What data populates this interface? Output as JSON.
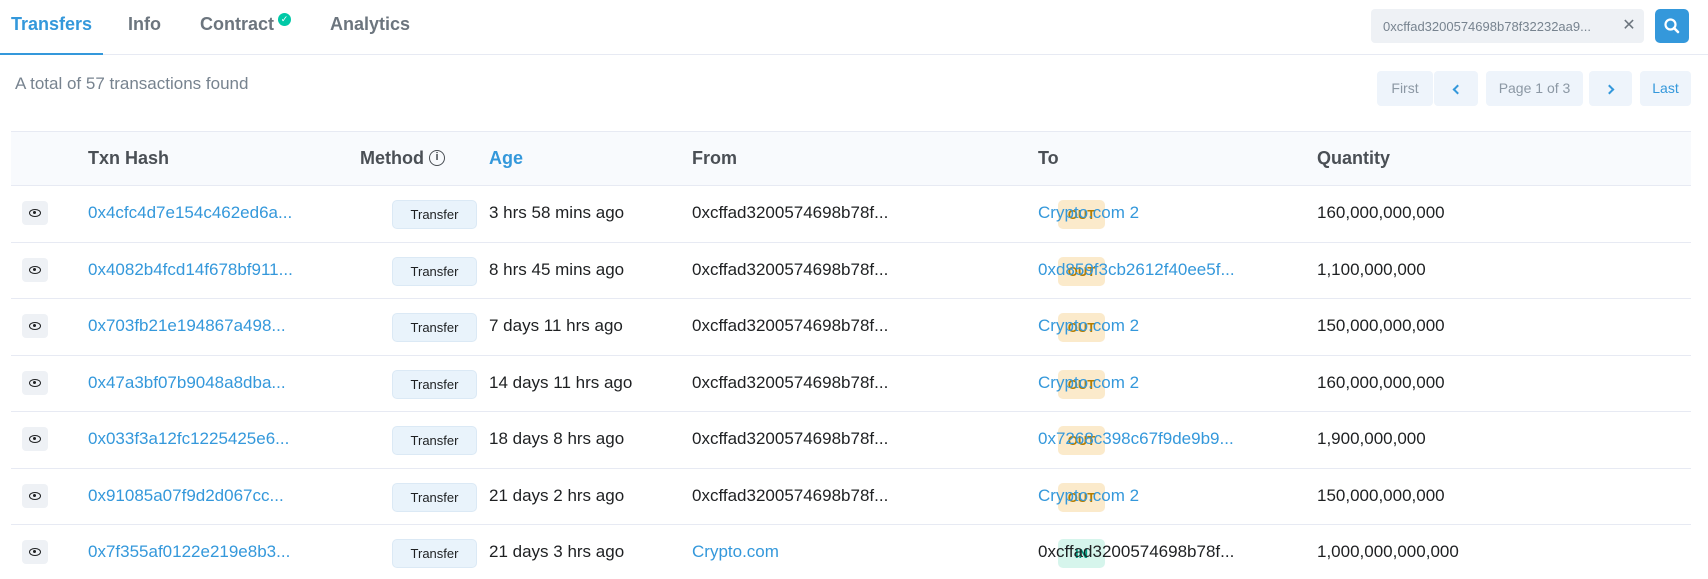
{
  "tabs": [
    {
      "label": "Transfers",
      "active": true
    },
    {
      "label": "Info",
      "active": false
    },
    {
      "label": "Contract",
      "active": false,
      "verified": true
    },
    {
      "label": "Analytics",
      "active": false
    }
  ],
  "search": {
    "value": "0xcffad3200574698b78f32232aa9...",
    "clear_icon": "close-icon",
    "button_icon": "search-icon"
  },
  "summary": "A total of 57 transactions found",
  "pagination": {
    "first": "First",
    "last": "Last",
    "page_info": "Page 1 of 3"
  },
  "table": {
    "headers": {
      "txn_hash": "Txn Hash",
      "method": "Method",
      "age": "Age",
      "from": "From",
      "to": "To",
      "quantity": "Quantity"
    },
    "rows": [
      {
        "hash": "0x4cfc4d7e154c462ed6a...",
        "method": "Transfer",
        "age": "3 hrs 58 mins ago",
        "from": "0xcffad3200574698b78f...",
        "from_link": false,
        "dir": "OUT",
        "to": "Crypto.com 2",
        "to_link": true,
        "quantity": "160,000,000,000"
      },
      {
        "hash": "0x4082b4fcd14f678bf911...",
        "method": "Transfer",
        "age": "8 hrs 45 mins ago",
        "from": "0xcffad3200574698b78f...",
        "from_link": false,
        "dir": "OUT",
        "to": "0xd859f3cb2612f40ee5f...",
        "to_link": true,
        "quantity": "1,100,000,000"
      },
      {
        "hash": "0x703fb21e194867a498...",
        "method": "Transfer",
        "age": "7 days 11 hrs ago",
        "from": "0xcffad3200574698b78f...",
        "from_link": false,
        "dir": "OUT",
        "to": "Crypto.com 2",
        "to_link": true,
        "quantity": "150,000,000,000"
      },
      {
        "hash": "0x47a3bf07b9048a8dba...",
        "method": "Transfer",
        "age": "14 days 11 hrs ago",
        "from": "0xcffad3200574698b78f...",
        "from_link": false,
        "dir": "OUT",
        "to": "Crypto.com 2",
        "to_link": true,
        "quantity": "160,000,000,000"
      },
      {
        "hash": "0x033f3a12fc1225425e6...",
        "method": "Transfer",
        "age": "18 days 8 hrs ago",
        "from": "0xcffad3200574698b78f...",
        "from_link": false,
        "dir": "OUT",
        "to": "0x7268c398c67f9de9b9...",
        "to_link": true,
        "quantity": "1,900,000,000"
      },
      {
        "hash": "0x91085a07f9d2d067cc...",
        "method": "Transfer",
        "age": "21 days 2 hrs ago",
        "from": "0xcffad3200574698b78f...",
        "from_link": false,
        "dir": "OUT",
        "to": "Crypto.com 2",
        "to_link": true,
        "quantity": "150,000,000,000"
      },
      {
        "hash": "0x7f355af0122e219e8b3...",
        "method": "Transfer",
        "age": "21 days 3 hrs ago",
        "from": "Crypto.com",
        "from_link": true,
        "dir": "IN",
        "to": "0xcffad3200574698b78f...",
        "to_link": false,
        "quantity": "1,000,000,000,000"
      }
    ]
  },
  "colors": {
    "accent": "#3498db",
    "out_badge": "#fbeacb",
    "in_badge": "#d6f5ec"
  }
}
